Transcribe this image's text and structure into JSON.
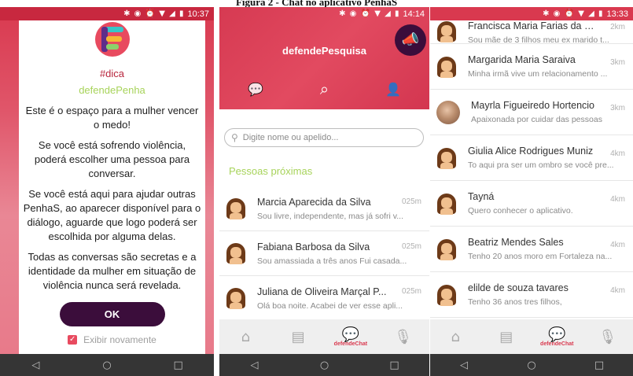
{
  "caption": "Figura 2 - Chat no aplicativo PenhaS",
  "phone1": {
    "time": "10:37",
    "dialog": {
      "tag": "#dica",
      "brand": "defendePenha",
      "paragraphs": [
        "Este é o espaço para a mulher vencer o medo!",
        "Se você está sofrendo violência, poderá escolher uma pessoa para conversar.",
        "Se você está aqui para ajudar outras PenhaS, ao aparecer disponível para o diálogo, aguarde que logo poderá ser escolhida por alguma delas.",
        "Todas as conversas são secretas e a identidade da mulher em situação de violência nunca será revelada."
      ],
      "ok_label": "OK",
      "checkbox_label": "Exibir novamente",
      "checkbox_checked": true
    }
  },
  "phone2": {
    "time": "14:14",
    "app_title": "defendePesquisa",
    "search_placeholder": "Digite nome ou apelido...",
    "section_title": "Pessoas próximas",
    "people": [
      {
        "name": "Marcia Aparecida da Silva",
        "distance": "025m",
        "message": "Sou livre, independente, mas já sofri v..."
      },
      {
        "name": "Fabiana Barbosa da Silva",
        "distance": "025m",
        "message": "Sou amassiada a três anos Fui casada..."
      },
      {
        "name": "Juliana de Oliveira Marçal P...",
        "distance": "025m",
        "message": "Olá boa noite. Acabei de ver esse apli..."
      }
    ],
    "tabs": {
      "active_label": "defendeChat"
    }
  },
  "phone3": {
    "time": "13:33",
    "people": [
      {
        "name": "Francisca Maria Farias da Silva",
        "distance": "2km",
        "message": "Sou mãe de 3 filhos meu ex marido t..."
      },
      {
        "name": "Margarida Maria Saraiva",
        "distance": "3km",
        "message": "Minha irmã vive um relacionamento ..."
      },
      {
        "name": "Mayrla Figueiredo Hortencio",
        "distance": "3km",
        "message": "Apaixonada por cuidar das pessoas",
        "photo": true
      },
      {
        "name": "Giulia Alice Rodrigues Muniz",
        "distance": "4km",
        "message": "To aqui pra ser um ombro se você pre..."
      },
      {
        "name": "Tayná",
        "distance": "4km",
        "message": "Quero conhecer o aplicativo."
      },
      {
        "name": "Beatriz Mendes Sales",
        "distance": "4km",
        "message": "Tenho 20 anos moro em Fortaleza na..."
      },
      {
        "name": "elilde de souza tavares",
        "distance": "4km",
        "message": "Tenho 36 anos tres filhos,"
      }
    ],
    "tabs": {
      "active_label": "defendeChat"
    }
  },
  "icons": {
    "home": "home-icon",
    "news": "news-icon",
    "chat": "chat-icon",
    "mic": "microphone-icon",
    "search": "search-icon",
    "megaphone": "megaphone-icon"
  },
  "colors": {
    "brand_red": "#d9394f",
    "brand_green": "#a7d35a",
    "dark_purple": "#3b0d3b"
  }
}
